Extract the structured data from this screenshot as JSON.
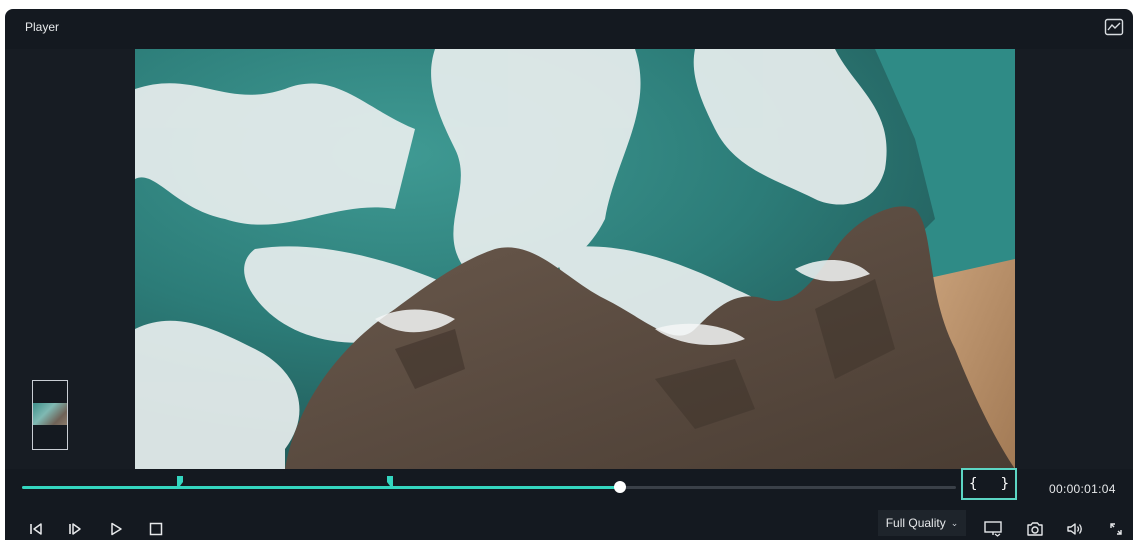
{
  "panel": {
    "title": "Player"
  },
  "icons": {
    "scope": "scope-chart-icon",
    "prev_frame": "previous-frame-icon",
    "next_frame": "next-frame-icon",
    "play": "play-icon",
    "stop": "stop-icon",
    "display": "display-settings-icon",
    "snapshot": "snapshot-camera-icon",
    "volume": "volume-icon",
    "fullscreen": "fullscreen-icon"
  },
  "playback": {
    "timecode": "00:00:01:04",
    "progress": 0.64
  },
  "in_out": {
    "open_brace": "{",
    "close_brace": "}"
  },
  "quality": {
    "selected": "Full Quality"
  },
  "colors": {
    "accent": "#34d6c0",
    "panel_bg": "#141920"
  }
}
